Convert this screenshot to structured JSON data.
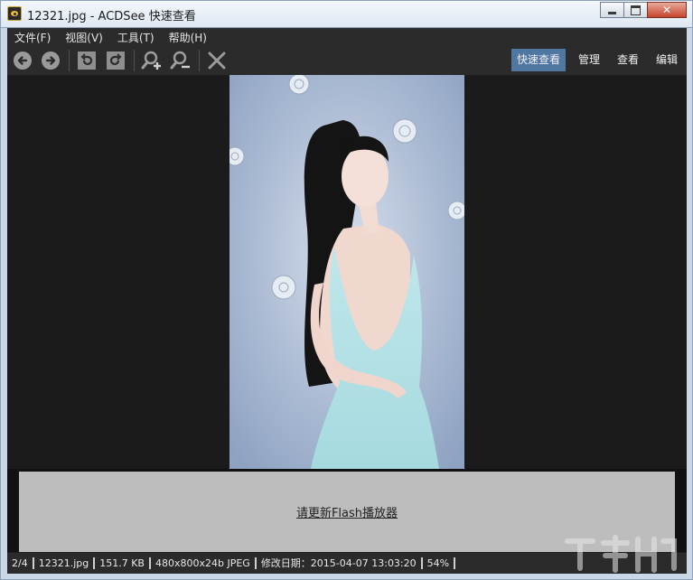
{
  "window": {
    "title": "12321.jpg - ACDSee 快速查看"
  },
  "menu": [
    "文件(F)",
    "视图(V)",
    "工具(T)",
    "帮助(H)"
  ],
  "toolbar": {
    "buttons": [
      "back-icon",
      "forward-icon",
      "rotate-left-icon",
      "rotate-right-icon",
      "zoom-in-icon",
      "zoom-out-icon",
      "close-icon"
    ],
    "modes": [
      "快速查看",
      "管理",
      "查看",
      "编辑"
    ],
    "active_mode": "快速查看"
  },
  "flash": {
    "message": "请更新Flash播放器"
  },
  "status": {
    "position": "2/4",
    "filename": "12321.jpg",
    "filesize": "151.7 KB",
    "dimensions": "480x800x24b JPEG",
    "modified": "修改日期：2015-04-07 13:03:20",
    "zoom": "54%"
  },
  "colors": {
    "accent": "#5077a2",
    "background": "#1b1b1b",
    "flash_panel": "#bdbdbd"
  }
}
